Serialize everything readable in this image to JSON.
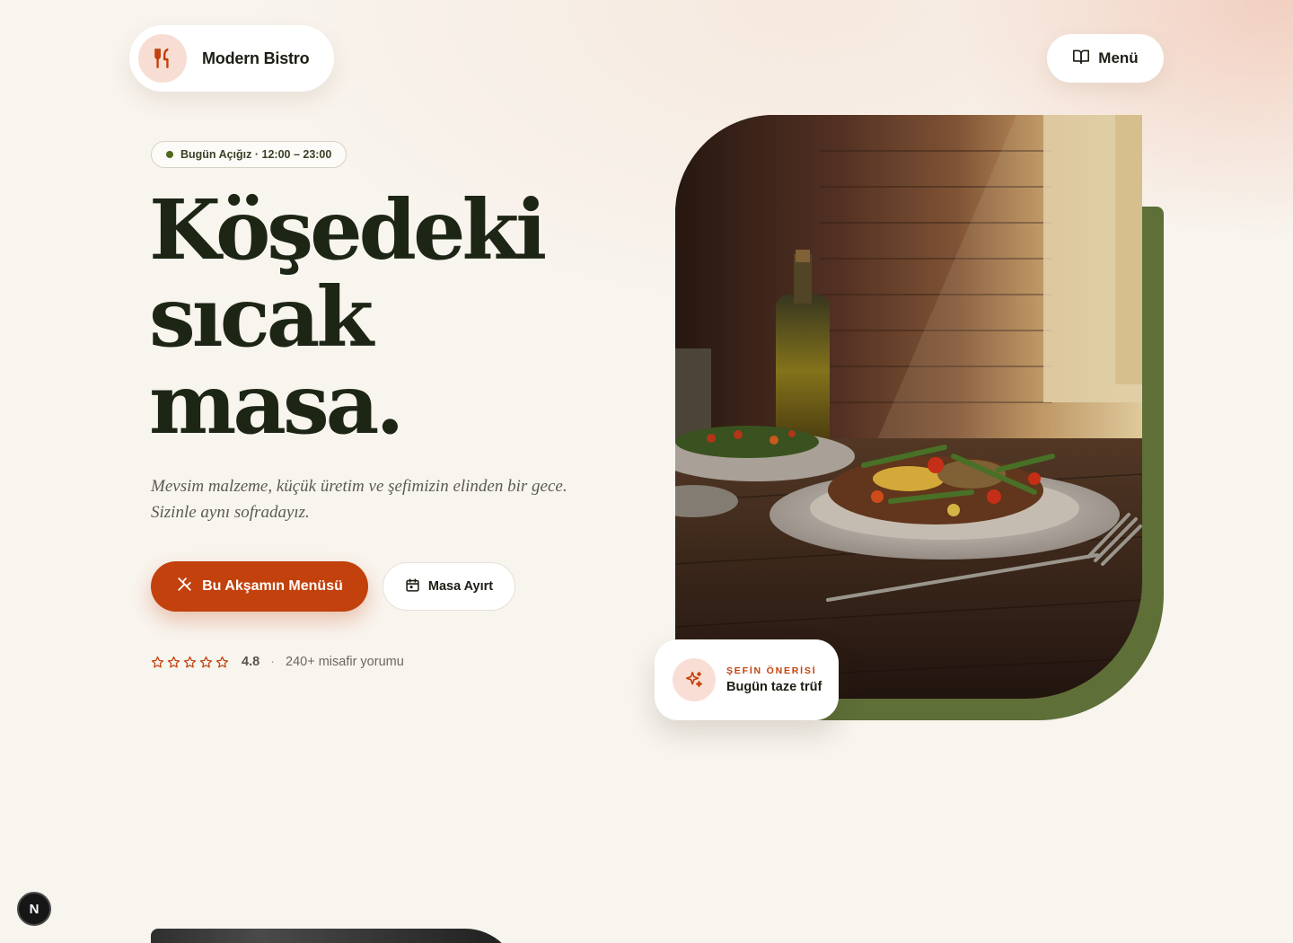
{
  "header": {
    "brand_name": "Modern Bistro",
    "brand_icon": "fork-knife-icon",
    "menu_label": "Menü",
    "menu_icon": "book-open-icon"
  },
  "hero": {
    "open_badge": "Bugün Açığız · 12:00 – 23:00",
    "title_lines": [
      "Köşedeki",
      "sıcak",
      "masa."
    ],
    "subtitle": "Mevsim malzeme, küçük üretim ve şefimizin elinden bir gece. Sizinle aynı sofradayız.",
    "primary_cta": "Bu Akşamın Menüsü",
    "secondary_cta": "Masa Ayırt",
    "rating": {
      "stars": 5,
      "value": "4.8",
      "separator": "·",
      "reviews": "240+ misafir yorumu"
    }
  },
  "feature_image": {
    "alt_semantic": "pasta-dish-photo",
    "chef_card": {
      "label": "ŞEFİN ÖNERİSİ",
      "value": "Bugün taze trüf",
      "icon": "sparkles-icon"
    }
  },
  "colors": {
    "accent": "#c2410c",
    "green": "#5e6f38",
    "background": "#f8f4ee",
    "ink": "#1d2615"
  },
  "dev_badge": "N"
}
